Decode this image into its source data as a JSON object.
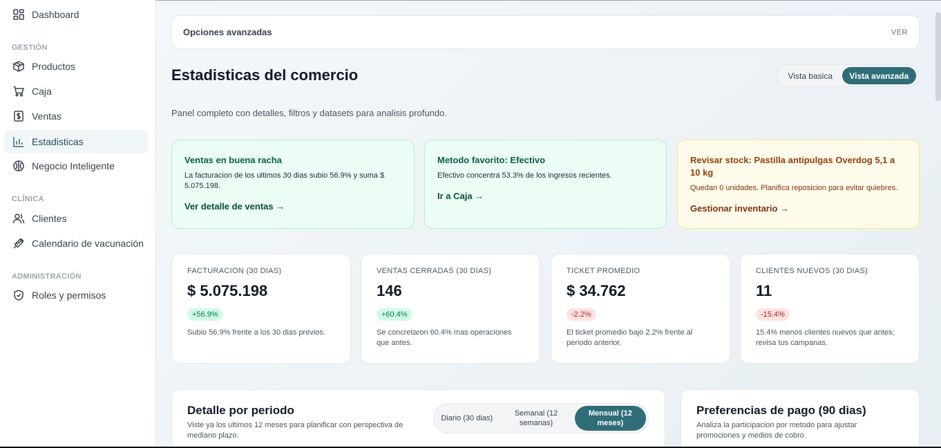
{
  "sidebar": {
    "dashboard": "Dashboard",
    "section_gestion": "GESTIÓN",
    "productos": "Productos",
    "caja": "Caja",
    "ventas": "Ventas",
    "estadisticas": "Estadisticas",
    "negocio": "Negocio Inteligente",
    "section_clinica": "CLÍNICA",
    "clientes": "Clientes",
    "calendario": "Calendario de vacunación",
    "section_admin": "ADMINISTRACIÓN",
    "roles": "Roles y permisos"
  },
  "advanced": {
    "title": "Opciones avanzadas",
    "action": "VER"
  },
  "header": {
    "title": "Estadisticas del comercio",
    "subtitle": "Panel completo con detalles, filtros y datasets para analisis profundo.",
    "view_basic": "Vista basica",
    "view_advanced": "Vista avanzada"
  },
  "insights": [
    {
      "title": "Ventas en buena racha",
      "text": "La facturacion de los ultimos 30 dias subio 56.9% y suma $ 5.075.198.",
      "link": "Ver detalle de ventas →"
    },
    {
      "title": "Metodo favorito: Efectivo",
      "text": "Efectivo concentra 53.3% de los ingresos recientes.",
      "link": "Ir a Caja →"
    },
    {
      "title": "Revisar stock: Pastilla antipulgas Overdog 5,1 a 10 kg",
      "text": "Quedan 0 unidades. Planifica reposicion para evitar quiebres.",
      "link": "Gestionar inventario →"
    }
  ],
  "kpis": [
    {
      "label": "FACTURACION (30 DIAS)",
      "value": "$ 5.075.198",
      "badge": "+56.9%",
      "desc": "Subio 56.9% frente a los 30 dias previos."
    },
    {
      "label": "VENTAS CERRADAS (30 DIAS)",
      "value": "146",
      "badge": "+60.4%",
      "desc": "Se concretaron 60.4% mas operaciones que antes."
    },
    {
      "label": "TICKET PROMEDIO",
      "value": "$ 34.762",
      "badge": "-2.2%",
      "desc": "El ticket promedio bajo 2.2% frente al periodo anterior."
    },
    {
      "label": "CLIENTES NUEVOS (30 DIAS)",
      "value": "11",
      "badge": "-15.4%",
      "desc": "15.4% menos clientes nuevos que antes; revisa tus campanas."
    }
  ],
  "periodo": {
    "title": "Detalle por periodo",
    "desc": "Viste ya los ultimos 12 meses para planificar con perspectiva de mediano plazo.",
    "options": [
      "Diario (30 dias)",
      "Semanal (12 semanas)",
      "Mensual (12 meses)"
    ]
  },
  "pago": {
    "title": "Preferencias de pago (90 dias)",
    "desc": "Analiza la participacion por metodo para ajustar promociones y medios de cobro."
  },
  "colors": {
    "accent": "#2f6e78",
    "positive": "#047857",
    "negative": "#b91c1c"
  }
}
